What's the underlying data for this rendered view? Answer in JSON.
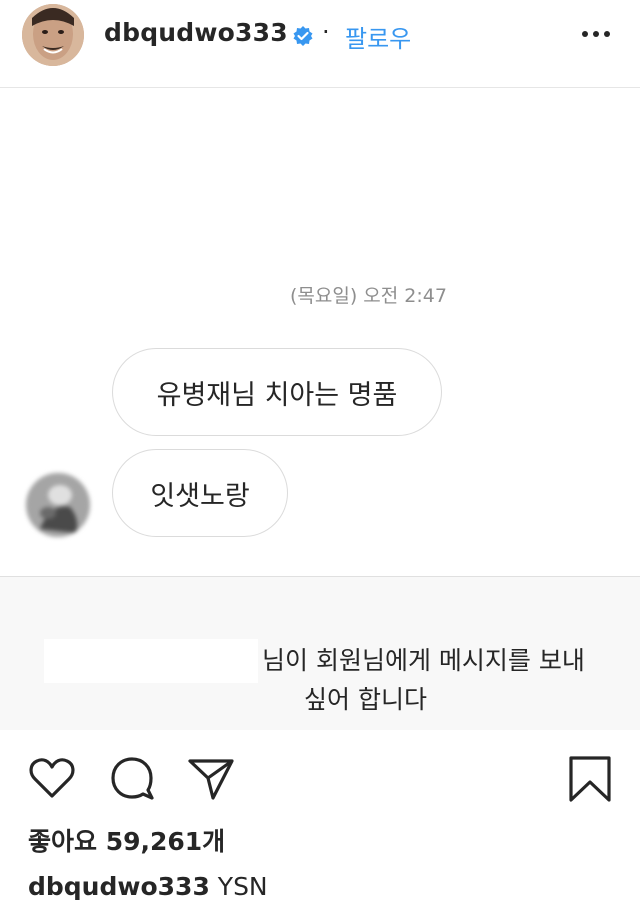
{
  "header": {
    "username": "dbqudwo333",
    "separator": "·",
    "follow_label": "팔로우",
    "more_icon": "more-horizontal-icon",
    "verified_icon": "verified-badge-icon"
  },
  "chat": {
    "timestamp": "(목요일) 오전 2:47",
    "messages": [
      {
        "text": "유병재님 치아는 명품"
      },
      {
        "text": "잇샛노랑"
      }
    ],
    "request_line1": "님이 회원님에게 메시지를 보내",
    "request_line2": "싶어 합니다"
  },
  "actions": {
    "like_icon": "heart-icon",
    "comment_icon": "comment-icon",
    "share_icon": "paper-plane-icon",
    "save_icon": "bookmark-icon"
  },
  "likes_text": "좋아요 59,261개",
  "caption": {
    "username": "dbqudwo333",
    "text": "YSN"
  },
  "colors": {
    "accent": "#3897f0",
    "text": "#262626",
    "muted": "#8e8e8e"
  }
}
